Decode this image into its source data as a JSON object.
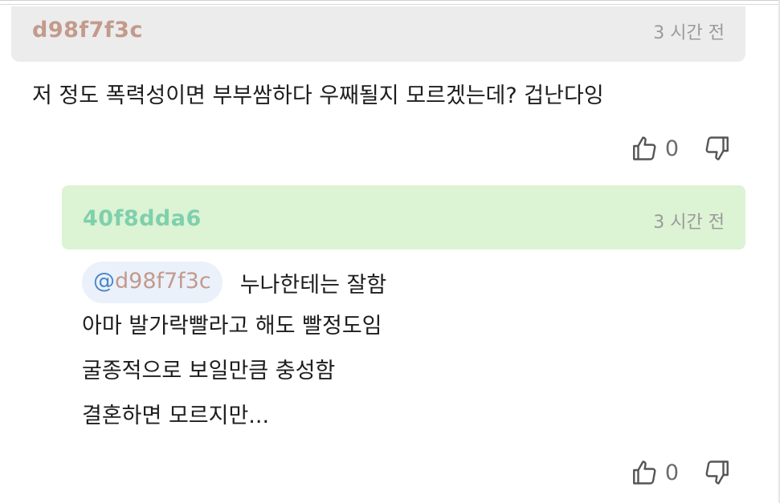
{
  "parent_comment": {
    "author": "d98f7f3c",
    "time": "3 시간 전",
    "text": "저 정도 폭력성이면 부부쌈하다 우째될지 모르겠는데? 겁난다잉",
    "likes": "0",
    "like_icon": "thumbs-up-icon",
    "dislike_icon": "thumbs-down-icon",
    "header_color": "#ececec",
    "author_color": "#c39a8c"
  },
  "reply_comment": {
    "author": "40f8dda6",
    "time": "3 시간 전",
    "mention_at": "@",
    "mention_name": "d98f7f3c",
    "lines": [
      "누나한테는 잘함",
      "아마 발가락빨라고 해도 빨정도임",
      "굴종적으로 보일만큼 충성함",
      "결혼하면 모르지만..."
    ],
    "likes": "0",
    "like_icon": "thumbs-up-icon",
    "dislike_icon": "thumbs-down-icon",
    "header_color": "#dcf3d4",
    "author_color": "#7fd0ac",
    "mention_color": "#4a86c7"
  }
}
